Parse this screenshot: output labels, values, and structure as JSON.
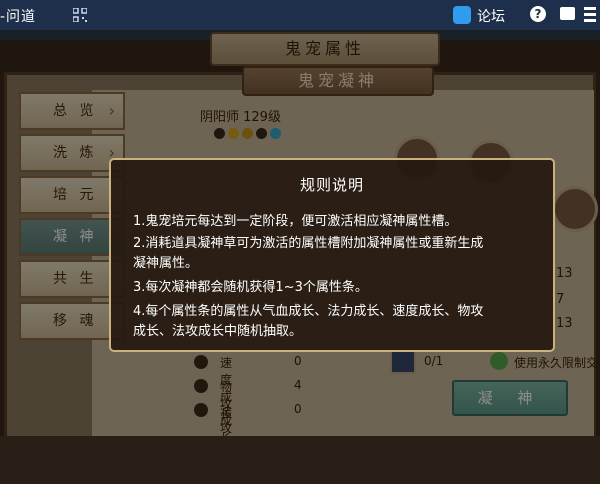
{
  "topbar": {
    "title": "-问道",
    "forum_label": "论坛",
    "help_glyph": "?"
  },
  "panel": {
    "header_main": "鬼宠属性",
    "header_sub": "鬼宠凝神",
    "character_name": "阴阳师 129级"
  },
  "side_tabs": [
    {
      "label": "总 览",
      "has_arrow": true
    },
    {
      "label": "洗 炼",
      "has_arrow": true
    },
    {
      "label": "培 元",
      "has_arrow": false
    },
    {
      "label": "凝 神",
      "has_arrow": false,
      "active": true
    },
    {
      "label": "共 生",
      "has_arrow": false
    },
    {
      "label": "移 魂",
      "has_arrow": false
    }
  ],
  "chevron_glyph": "›",
  "stats": [
    {
      "label": "速度成长",
      "value": "0"
    },
    {
      "label": "物攻成长",
      "value": "4"
    },
    {
      "label": "法攻成长",
      "value": "0"
    }
  ],
  "right_values": [
    "13",
    "7",
    "13"
  ],
  "item": {
    "count": "0/1"
  },
  "permanent_option": "使用永久限制交",
  "action_button": "凝 神",
  "modal": {
    "title": "规则说明",
    "rules": [
      "1.鬼宠培元每达到一定阶段，便可激活相应凝神属性槽。",
      "2.消耗道具凝神草可为激活的属性槽附加凝神属性或重新生成",
      "   凝神属性。",
      "3.每次凝神都会随机获得1~3个属性条。",
      "4.每个属性条的属性从气血成长、法力成长、速度成长、物攻",
      "   成长、法攻成长中随机抽取。"
    ]
  }
}
